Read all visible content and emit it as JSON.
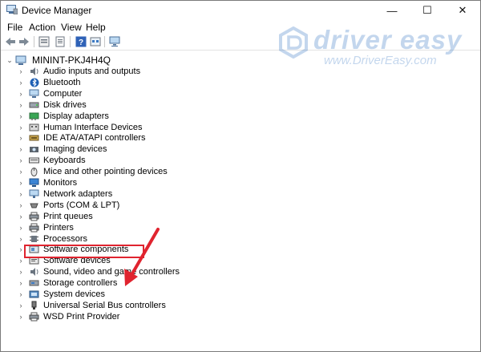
{
  "window": {
    "title": "Device Manager"
  },
  "title_controls": {
    "minimize": "—",
    "maximize": "☐",
    "close": "✕"
  },
  "menu": [
    "File",
    "Action",
    "View",
    "Help"
  ],
  "toolbar": [
    "back-icon",
    "forward-icon",
    "properties-icon",
    "update-icon",
    "help-icon",
    "device-view-icon",
    "monitor-icon"
  ],
  "watermark": {
    "brand": "driver easy",
    "url": "www.DriverEasy.com"
  },
  "tree": {
    "root": "MININT-PKJ4H4Q",
    "items": [
      {
        "label": "Audio inputs and outputs",
        "icon": "speaker-icon"
      },
      {
        "label": "Bluetooth",
        "icon": "bluetooth-icon"
      },
      {
        "label": "Computer",
        "icon": "computer-icon"
      },
      {
        "label": "Disk drives",
        "icon": "disk-icon"
      },
      {
        "label": "Display adapters",
        "icon": "display-adapter-icon"
      },
      {
        "label": "Human Interface Devices",
        "icon": "hid-icon"
      },
      {
        "label": "IDE ATA/ATAPI controllers",
        "icon": "ide-icon"
      },
      {
        "label": "Imaging devices",
        "icon": "camera-icon"
      },
      {
        "label": "Keyboards",
        "icon": "keyboard-icon"
      },
      {
        "label": "Mice and other pointing devices",
        "icon": "mouse-icon"
      },
      {
        "label": "Monitors",
        "icon": "monitor-icon"
      },
      {
        "label": "Network adapters",
        "icon": "network-icon"
      },
      {
        "label": "Ports (COM & LPT)",
        "icon": "port-icon"
      },
      {
        "label": "Print queues",
        "icon": "printer-icon"
      },
      {
        "label": "Printers",
        "icon": "printer-icon"
      },
      {
        "label": "Processors",
        "icon": "chip-icon"
      },
      {
        "label": "Software components",
        "icon": "component-icon"
      },
      {
        "label": "Software devices",
        "icon": "software-device-icon"
      },
      {
        "label": "Sound, video and game controllers",
        "icon": "speaker-icon"
      },
      {
        "label": "Storage controllers",
        "icon": "storage-icon"
      },
      {
        "label": "System devices",
        "icon": "system-icon"
      },
      {
        "label": "Universal Serial Bus controllers",
        "icon": "usb-icon"
      },
      {
        "label": "WSD Print Provider",
        "icon": "printer-icon"
      }
    ]
  },
  "colors": {
    "highlight": "#e0242f",
    "arrow": "#e0242f",
    "watermark": "#2a6fbf"
  }
}
